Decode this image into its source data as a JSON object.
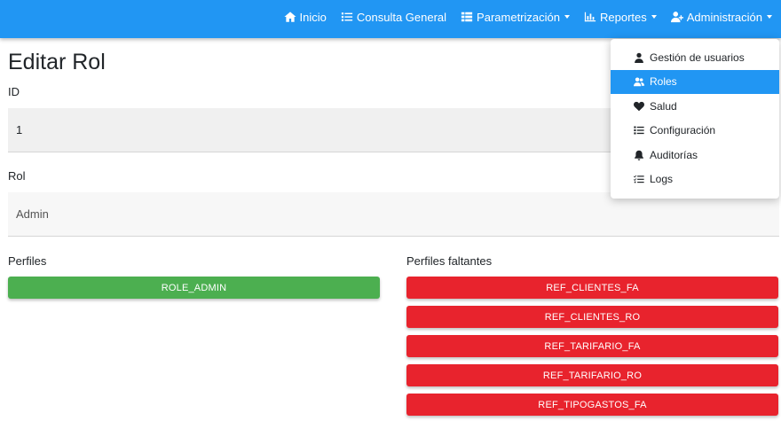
{
  "navbar": {
    "items": [
      {
        "label": "Inicio",
        "icon": "home-icon",
        "dropdown": false
      },
      {
        "label": "Consulta General",
        "icon": "list-icon",
        "dropdown": false
      },
      {
        "label": "Parametrización",
        "icon": "table-list-icon",
        "dropdown": true
      },
      {
        "label": "Reportes",
        "icon": "bar-chart-icon",
        "dropdown": true
      },
      {
        "label": "Administración",
        "icon": "user-plus-icon",
        "dropdown": true
      }
    ],
    "color": "#2196f3"
  },
  "page": {
    "title": "Editar Rol",
    "id_label": "ID",
    "id_value": "1",
    "rol_label": "Rol",
    "rol_value": "Admin",
    "perfiles_label": "Perfiles",
    "faltantes_label": "Perfiles faltantes"
  },
  "perfiles": [
    "ROLE_ADMIN"
  ],
  "perfiles_faltantes": [
    "REF_CLIENTES_FA",
    "REF_CLIENTES_RO",
    "REF_TARIFARIO_FA",
    "REF_TARIFARIO_RO",
    "REF_TIPOGASTOS_FA"
  ],
  "admin_menu": {
    "items": [
      {
        "label": "Gestión de usuarios",
        "icon": "user-icon",
        "active": false
      },
      {
        "label": "Roles",
        "icon": "users-icon",
        "active": true
      },
      {
        "label": "Salud",
        "icon": "heart-icon",
        "active": false
      },
      {
        "label": "Configuración",
        "icon": "list-icon",
        "active": false
      },
      {
        "label": "Auditorías",
        "icon": "bell-icon",
        "active": false
      },
      {
        "label": "Logs",
        "icon": "tasks-icon",
        "active": false
      }
    ]
  },
  "colors": {
    "green": "#4caf50",
    "red": "#e8232d",
    "active": "#2196f3"
  }
}
